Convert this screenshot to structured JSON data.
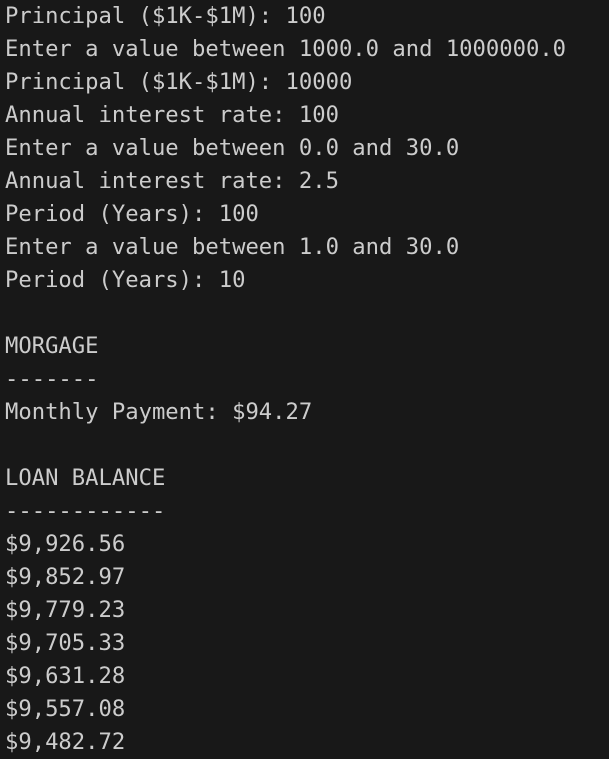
{
  "terminal": {
    "lines": [
      "Principal ($1K-$1M): 100",
      "Enter a value between 1000.0 and 1000000.0",
      "Principal ($1K-$1M): 10000",
      "Annual interest rate: 100",
      "Enter a value between 0.0 and 30.0",
      "Annual interest rate: 2.5",
      "Period (Years): 100",
      "Enter a value between 1.0 and 30.0",
      "Period (Years): 10",
      "",
      "MORGAGE",
      "-------",
      "Monthly Payment: $94.27",
      "",
      "LOAN BALANCE",
      "------------",
      "$9,926.56",
      "$9,852.97",
      "$9,779.23",
      "$9,705.33",
      "$9,631.28",
      "$9,557.08",
      "$9,482.72"
    ]
  },
  "colors": {
    "background": "#181818",
    "text": "#cccccc"
  }
}
